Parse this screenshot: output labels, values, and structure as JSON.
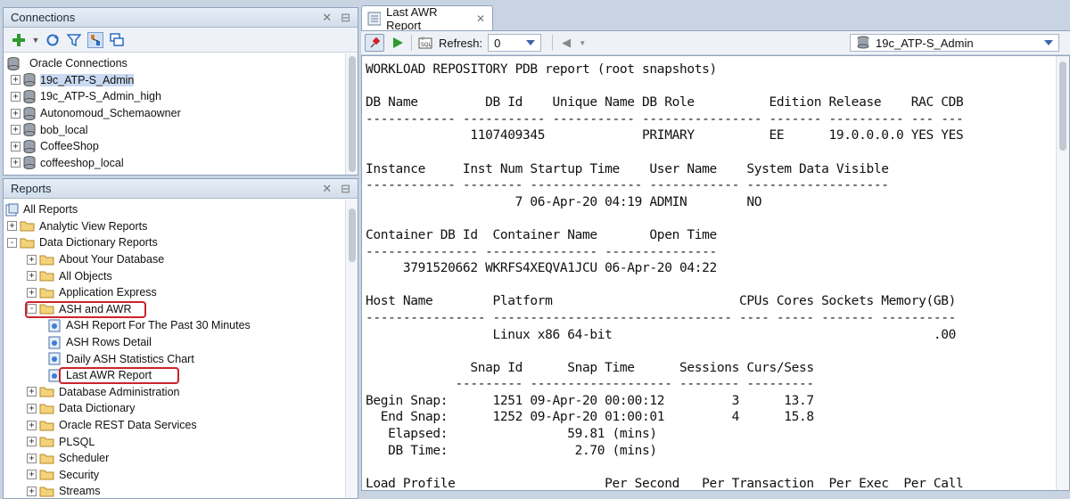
{
  "connections": {
    "title": "Connections",
    "root_label": "Oracle Connections",
    "items": [
      {
        "label": "19c_ATP-S_Admin",
        "selected": true
      },
      {
        "label": "19c_ATP-S_Admin_high"
      },
      {
        "label": "Autonomoud_Schemaowner"
      },
      {
        "label": "bob_local"
      },
      {
        "label": "CoffeeShop"
      },
      {
        "label": "coffeeshop_local"
      }
    ]
  },
  "reports": {
    "title": "Reports",
    "tree": [
      {
        "label": "All Reports",
        "level": 0,
        "kind": "root"
      },
      {
        "label": "Analytic View Reports",
        "level": 1,
        "kind": "folder",
        "exp": "+"
      },
      {
        "label": "Data Dictionary Reports",
        "level": 1,
        "kind": "folder",
        "exp": "-"
      },
      {
        "label": "About Your Database",
        "level": 2,
        "kind": "folder",
        "exp": "+"
      },
      {
        "label": "All Objects",
        "level": 2,
        "kind": "folder",
        "exp": "+"
      },
      {
        "label": "Application Express",
        "level": 2,
        "kind": "folder",
        "exp": "+"
      },
      {
        "label": "ASH and AWR",
        "level": 2,
        "kind": "folder",
        "exp": "-",
        "highlight": true
      },
      {
        "label": "ASH Report For The Past 30 Minutes",
        "level": 3,
        "kind": "report"
      },
      {
        "label": "ASH Rows Detail",
        "level": 3,
        "kind": "report"
      },
      {
        "label": "Daily ASH Statistics Chart",
        "level": 3,
        "kind": "report"
      },
      {
        "label": "Last AWR Report",
        "level": 3,
        "kind": "report",
        "highlight": true
      },
      {
        "label": "Database Administration",
        "level": 2,
        "kind": "folder",
        "exp": "+"
      },
      {
        "label": "Data Dictionary",
        "level": 2,
        "kind": "folder",
        "exp": "+"
      },
      {
        "label": "Oracle REST Data Services",
        "level": 2,
        "kind": "folder",
        "exp": "+"
      },
      {
        "label": "PLSQL",
        "level": 2,
        "kind": "folder",
        "exp": "+"
      },
      {
        "label": "Scheduler",
        "level": 2,
        "kind": "folder",
        "exp": "+"
      },
      {
        "label": "Security",
        "level": 2,
        "kind": "folder",
        "exp": "+"
      },
      {
        "label": "Streams",
        "level": 2,
        "kind": "folder",
        "exp": "+"
      }
    ]
  },
  "editor": {
    "tab_label": "Last AWR Report",
    "refresh_label": "Refresh:",
    "refresh_value": "0",
    "connection": "19c_ATP-S_Admin",
    "report_lines": [
      "WORKLOAD REPOSITORY PDB report (root snapshots)",
      "",
      "DB Name         DB Id    Unique Name DB Role          Edition Release    RAC CDB",
      "------------ ----------- ----------- ---------------- ------- ---------- --- ---",
      "              1107409345             PRIMARY          EE      19.0.0.0.0 YES YES",
      "",
      "Instance     Inst Num Startup Time    User Name    System Data Visible",
      "------------ -------- --------------- ------------ -------------------",
      "                    7 06-Apr-20 04:19 ADMIN        NO",
      "",
      "Container DB Id  Container Name       Open Time",
      "--------------- --------------- ---------------",
      "     3791520662 WKRFS4XEQVA1JCU 06-Apr-20 04:22",
      "",
      "Host Name        Platform                         CPUs Cores Sockets Memory(GB)",
      "---------------- -------------------------------- ---- ----- ------- ----------",
      "                 Linux x86 64-bit                                           .00",
      "",
      "              Snap Id      Snap Time      Sessions Curs/Sess",
      "            --------- ------------------- -------- ---------",
      "Begin Snap:      1251 09-Apr-20 00:00:12         3      13.7",
      "  End Snap:      1252 09-Apr-20 01:00:01         4      15.8",
      "   Elapsed:                59.81 (mins)",
      "   DB Time:                 2.70 (mins)",
      "",
      "Load Profile                    Per Second   Per Transaction  Per Exec  Per Call"
    ]
  },
  "icons": {
    "add": "add-connection-icon",
    "refresh": "refresh-icon",
    "filter": "filter-icon",
    "schema": "schema-browser-icon",
    "pin": "pin-icon",
    "run": "run-icon",
    "sql": "sql-icon",
    "nav": "back-nav-icon"
  }
}
